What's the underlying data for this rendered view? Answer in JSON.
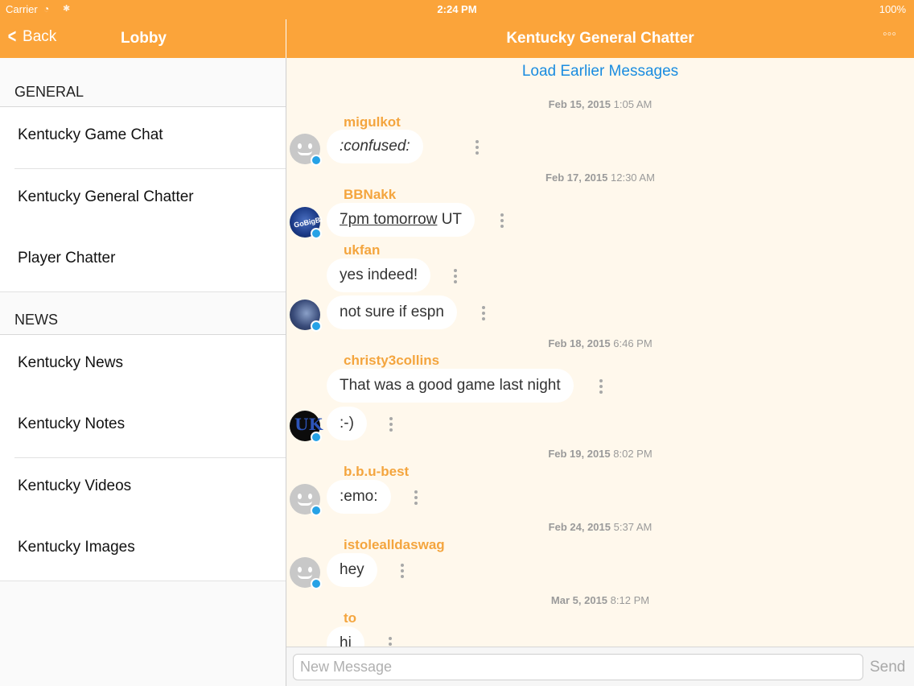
{
  "status_bar": {
    "carrier": "Carrier",
    "time": "2:24 PM",
    "battery": "100%"
  },
  "left_nav": {
    "back_label": "Back",
    "title": "Lobby"
  },
  "chat_nav": {
    "title": "Kentucky General Chatter",
    "more": "◦◦◦"
  },
  "sidebar": {
    "sections": [
      {
        "header": "GENERAL",
        "items": [
          "Kentucky Game Chat",
          "Kentucky General Chatter",
          "Player Chatter"
        ]
      },
      {
        "header": "NEWS",
        "items": [
          "Kentucky News",
          "Kentucky Notes",
          "Kentucky Videos",
          "Kentucky Images"
        ]
      }
    ]
  },
  "chat": {
    "load_earlier": "Load Earlier Messages",
    "dates": [
      {
        "day": "Feb 15, 2015",
        "time": "1:05 AM"
      },
      {
        "day": "Feb 17, 2015",
        "time": "12:30 AM"
      },
      {
        "day": "Feb 18, 2015",
        "time": "6:46 PM"
      },
      {
        "day": "Feb 19, 2015",
        "time": "8:02 PM"
      },
      {
        "day": "Feb 24, 2015",
        "time": "5:37 AM"
      },
      {
        "day": "Mar 5, 2015",
        "time": "8:12 PM"
      }
    ],
    "usernames": [
      "migulkot",
      "BBNakk",
      "ukfan",
      "christy3collins",
      "b.b.u-best",
      "istolealldaswag",
      "to"
    ],
    "messages": [
      {
        "text": ":confused:"
      },
      {
        "link": "7pm tomorrow",
        "text": " UT"
      },
      {
        "text": "yes indeed!"
      },
      {
        "text": "not sure if espn"
      },
      {
        "text": "That was a good game last night"
      },
      {
        "text": ":-)"
      },
      {
        "text": ":emo:"
      },
      {
        "text": "hey"
      },
      {
        "text": "hi"
      }
    ],
    "avatar_texts": {
      "bbnakk": "GoBigBl",
      "uk": "UK"
    }
  },
  "composer": {
    "placeholder": "New Message",
    "send_label": "Send"
  },
  "colors": {
    "accent": "#fba43a",
    "username": "#f4a53e",
    "link": "#1a8ce0",
    "chat_bg": "#fff8ec",
    "badge": "#26a2e6"
  }
}
